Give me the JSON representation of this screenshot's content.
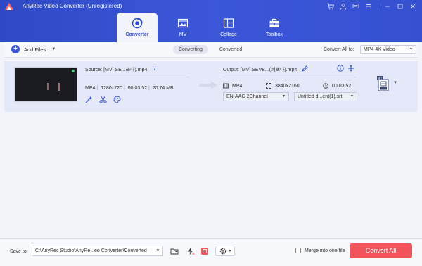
{
  "window": {
    "title": "AnyRec Video Converter (Unregistered)"
  },
  "tabs": [
    {
      "label": "Converter",
      "icon": "converter-icon",
      "active": true
    },
    {
      "label": "MV",
      "icon": "mv-icon",
      "active": false
    },
    {
      "label": "Collage",
      "icon": "collage-icon",
      "active": false
    },
    {
      "label": "Toolbox",
      "icon": "toolbox-icon",
      "active": false
    }
  ],
  "toolbar": {
    "add_files_label": "Add Files",
    "segments": [
      "Converting",
      "Converted"
    ],
    "convert_all_label": "Convert All to:",
    "convert_all_value": "MP4 4K Video"
  },
  "file": {
    "source_name": "Source: [MV] SE...쓰다).mp4",
    "format": "MP4",
    "resolution": "1280x720",
    "duration": "00:03:52",
    "size": "20.74 MB",
    "output_name": "Output: [MV] SEVE...(예쁘다).mp4",
    "output_format": "MP4",
    "output_resolution": "3840x2160",
    "output_duration": "00:03:52",
    "audio_track": "EN-AAC-2Channel",
    "subtitle": "Untitled d...ent(1).srt",
    "format_badge": "4K"
  },
  "footer": {
    "save_label": "Save to:",
    "save_path": "C:\\AnyRec Studio\\AnyRe...eo Converter\\Converted",
    "merge_label": "Merge into one file",
    "convert_all_button": "Convert All"
  },
  "colors": {
    "header": "#3b56d8",
    "accent": "#3b56d8",
    "convert_button": "#f1545c"
  }
}
